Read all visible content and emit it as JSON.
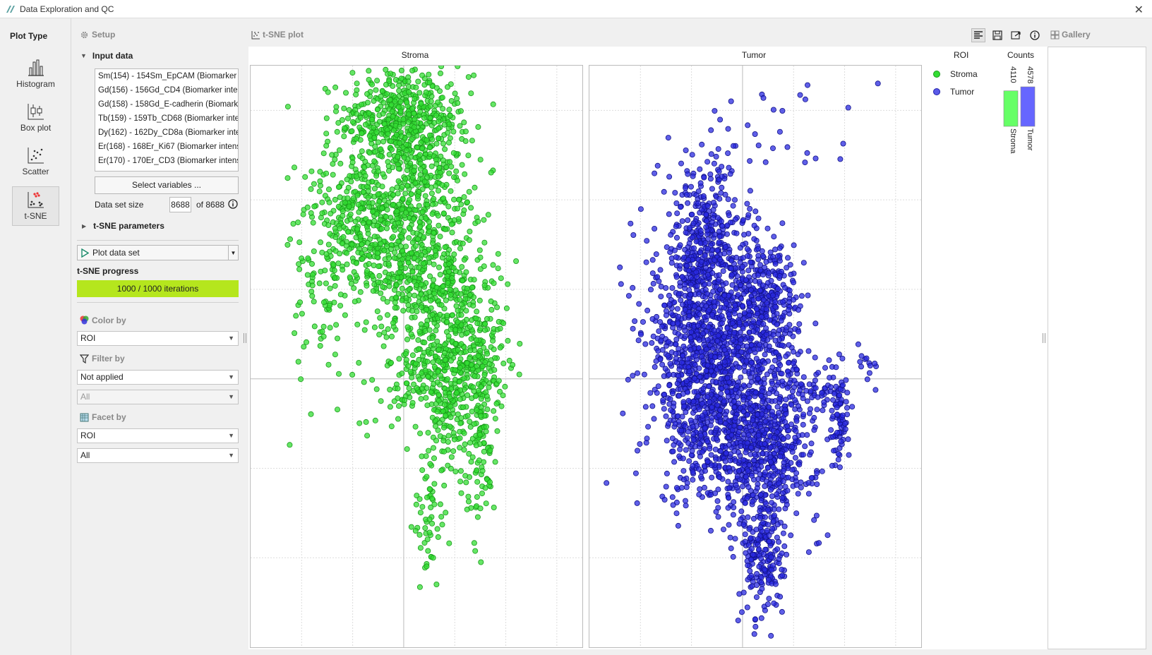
{
  "window": {
    "title": "Data Exploration and QC"
  },
  "plot_type": {
    "header": "Plot Type",
    "items": [
      {
        "label": "Histogram",
        "icon": "histogram-icon"
      },
      {
        "label": "Box plot",
        "icon": "boxplot-icon"
      },
      {
        "label": "Scatter",
        "icon": "scatter-icon"
      },
      {
        "label": "t-SNE",
        "icon": "tsne-icon",
        "active": true
      }
    ]
  },
  "setup": {
    "header": "Setup",
    "input_data_label": "Input data",
    "variables": [
      "Sm(154) - 154Sm_EpCAM (Biomarker",
      "Gd(156) - 156Gd_CD4 (Biomarker inte",
      "Gd(158) - 158Gd_E-cadherin (Biomark",
      "Tb(159) - 159Tb_CD68 (Biomarker inte",
      "Dy(162) - 162Dy_CD8a (Biomarker inte",
      "Er(168) - 168Er_Ki67 (Biomarker intens",
      "Er(170) - 170Er_CD3 (Biomarker intens"
    ],
    "select_variables_label": "Select variables ...",
    "dataset_size_label": "Data set size",
    "dataset_size_value": "8688",
    "dataset_size_total": "of 8688",
    "tsne_params_label": "t-SNE parameters",
    "plot_button_label": "Plot data set",
    "progress_label": "t-SNE progress",
    "progress_text": "1000 / 1000 iterations",
    "progress_fraction": 1.0,
    "color_by_label": "Color by",
    "color_by_value": "ROI",
    "filter_by_label": "Filter by",
    "filter_by_value": "Not applied",
    "filter_by_sub_value": "All",
    "facet_by_label": "Facet by",
    "facet_by_value": "ROI",
    "facet_by_sub_value": "All"
  },
  "plot": {
    "header": "t-SNE plot",
    "gallery_label": "Gallery",
    "legend_title": "ROI",
    "counts_title": "Counts"
  },
  "colors": {
    "stroma": "#33dd33",
    "tumor": "#2222dd",
    "progress": "#b5e61d"
  },
  "chart_data": {
    "type": "scatter",
    "facets": [
      "Stroma",
      "Tumor"
    ],
    "xlim": [
      -60,
      70
    ],
    "ylim": [
      -60,
      70
    ],
    "series": [
      {
        "name": "Stroma",
        "count": 4110,
        "color": "#33dd33"
      },
      {
        "name": "Tumor",
        "count": 4578,
        "color": "#2222dd"
      }
    ],
    "counts": [
      {
        "label": "Stroma",
        "value": 4110
      },
      {
        "label": "Tumor",
        "value": 4578
      }
    ]
  }
}
